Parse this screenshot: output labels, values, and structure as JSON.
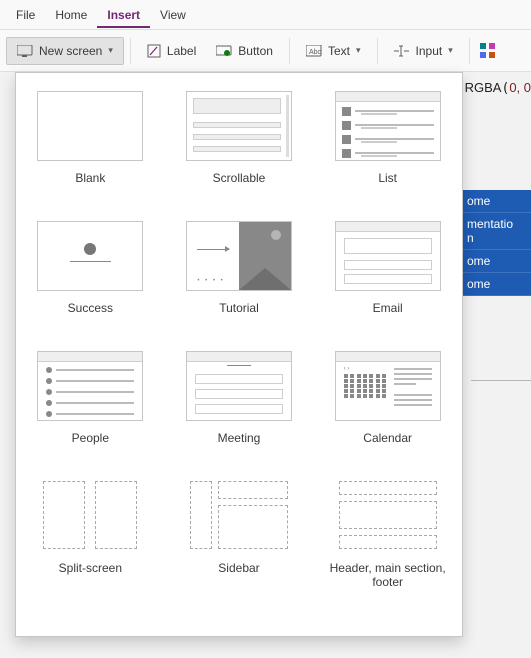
{
  "menubar": {
    "items": [
      "File",
      "Home",
      "Insert",
      "View"
    ],
    "active_index": 2
  },
  "toolbar": {
    "new_screen": {
      "label": "New screen"
    },
    "label": {
      "label": "Label"
    },
    "button": {
      "label": "Button"
    },
    "text": {
      "label": "Text"
    },
    "input": {
      "label": "Input"
    }
  },
  "formula_bar": {
    "fn": "RGBA",
    "args_visible": "0, 0"
  },
  "tree_partial": [
    "ome",
    "mentatio",
    "n",
    "ome",
    "ome"
  ],
  "gallery": {
    "items": [
      {
        "key": "blank",
        "label": "Blank"
      },
      {
        "key": "scrollable",
        "label": "Scrollable"
      },
      {
        "key": "list",
        "label": "List"
      },
      {
        "key": "success",
        "label": "Success"
      },
      {
        "key": "tutorial",
        "label": "Tutorial"
      },
      {
        "key": "email",
        "label": "Email"
      },
      {
        "key": "people",
        "label": "People"
      },
      {
        "key": "meeting",
        "label": "Meeting"
      },
      {
        "key": "calendar",
        "label": "Calendar"
      },
      {
        "key": "split",
        "label": "Split-screen"
      },
      {
        "key": "sidebar",
        "label": "Sidebar"
      },
      {
        "key": "hmsf",
        "label": "Header, main section, footer"
      }
    ]
  }
}
